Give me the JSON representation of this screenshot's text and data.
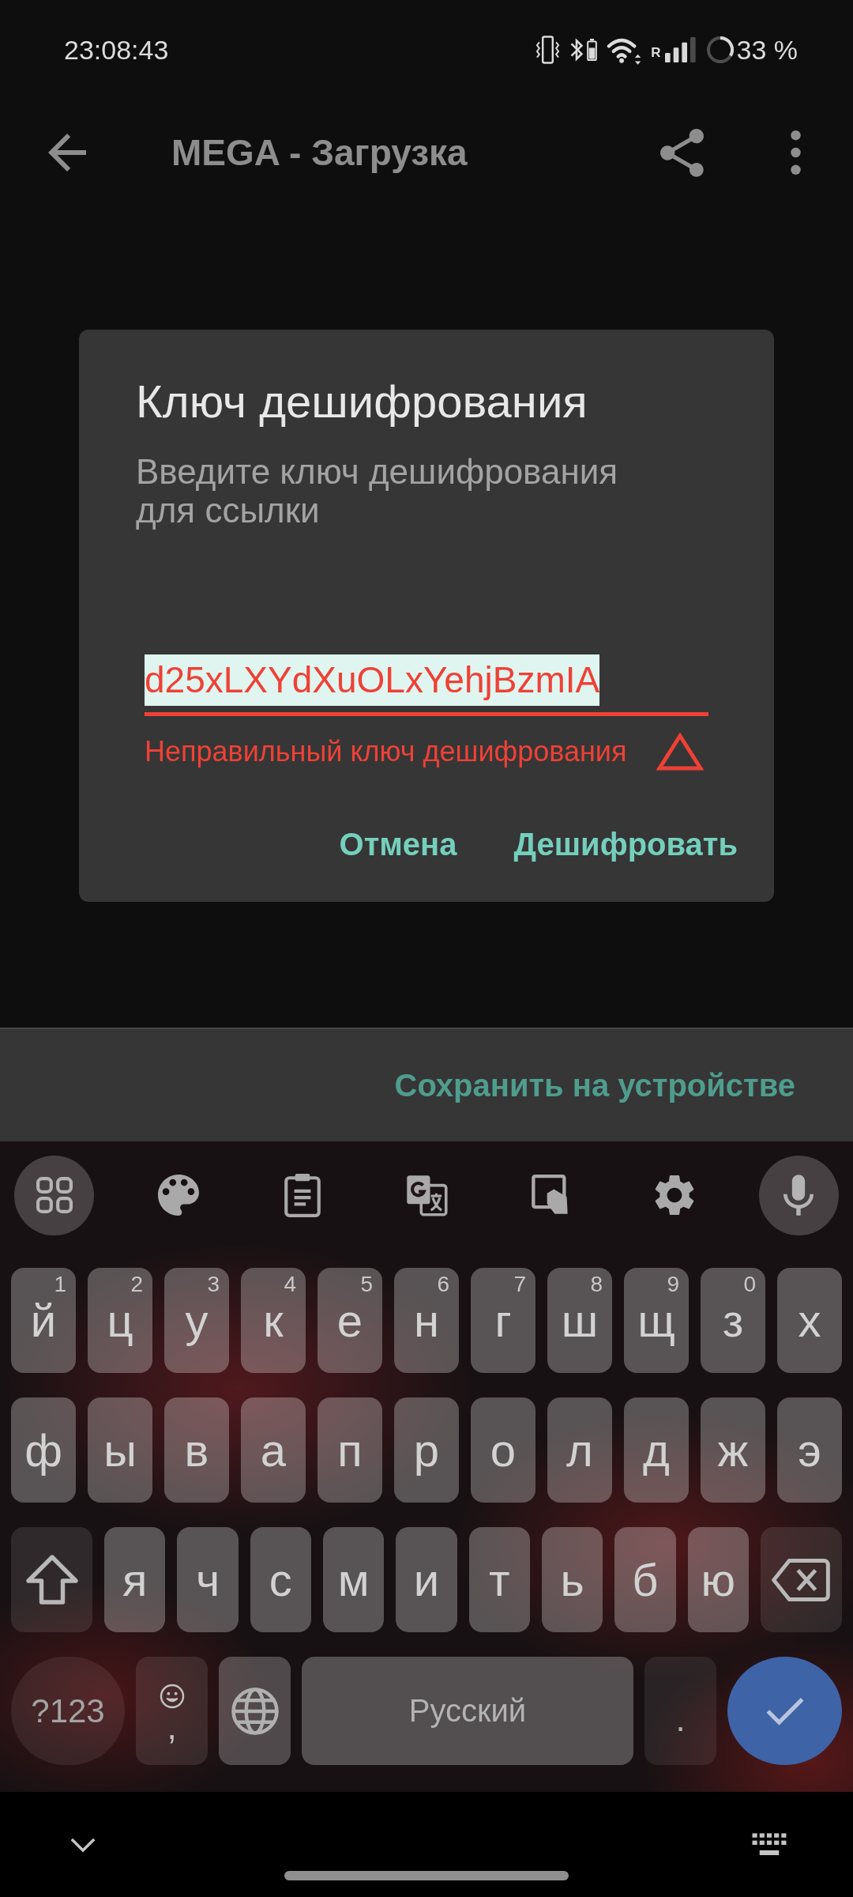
{
  "status_bar": {
    "time": "23:08:43",
    "network_label": "R",
    "battery": "33 %"
  },
  "app_bar": {
    "title": "MEGA - Загрузка"
  },
  "dialog": {
    "title": "Ключ дешифрования",
    "message": "Введите ключ дешифрования для ссылки",
    "field": {
      "value": "d25xLXYdXuOLxYehjBzmIA",
      "selected": true,
      "error": "Неправильный ключ дешифрования"
    },
    "buttons": [
      "Отмена",
      "Дешифровать"
    ]
  },
  "bottom_bar": {
    "button": "Сохранить на устройстве"
  },
  "keyboard": {
    "rows": [
      [
        {
          "kind": "letter",
          "label": "й",
          "hint": "1"
        },
        {
          "kind": "letter",
          "label": "ц",
          "hint": "2"
        },
        {
          "kind": "letter",
          "label": "у",
          "hint": "3"
        },
        {
          "kind": "letter",
          "label": "к",
          "hint": "4"
        },
        {
          "kind": "letter",
          "label": "е",
          "hint": "5"
        },
        {
          "kind": "letter",
          "label": "н",
          "hint": "6"
        },
        {
          "kind": "letter",
          "label": "г",
          "hint": "7"
        },
        {
          "kind": "letter",
          "label": "ш",
          "hint": "8"
        },
        {
          "kind": "letter",
          "label": "щ",
          "hint": "9"
        },
        {
          "kind": "letter",
          "label": "з",
          "hint": "0"
        },
        {
          "kind": "letter",
          "label": "х"
        }
      ],
      [
        {
          "kind": "letter",
          "label": "ф"
        },
        {
          "kind": "letter",
          "label": "ы"
        },
        {
          "kind": "letter",
          "label": "в"
        },
        {
          "kind": "letter",
          "label": "а"
        },
        {
          "kind": "letter",
          "label": "п"
        },
        {
          "kind": "letter",
          "label": "р"
        },
        {
          "kind": "letter",
          "label": "о"
        },
        {
          "kind": "letter",
          "label": "л"
        },
        {
          "kind": "letter",
          "label": "д"
        },
        {
          "kind": "letter",
          "label": "ж"
        },
        {
          "kind": "letter",
          "label": "э"
        }
      ],
      [
        {
          "kind": "shift"
        },
        {
          "kind": "letter",
          "label": "я"
        },
        {
          "kind": "letter",
          "label": "ч"
        },
        {
          "kind": "letter",
          "label": "с"
        },
        {
          "kind": "letter",
          "label": "м"
        },
        {
          "kind": "letter",
          "label": "и"
        },
        {
          "kind": "letter",
          "label": "т"
        },
        {
          "kind": "letter",
          "label": "ь"
        },
        {
          "kind": "letter",
          "label": "б"
        },
        {
          "kind": "letter",
          "label": "ю"
        },
        {
          "kind": "delete"
        }
      ]
    ],
    "bottom_row": [
      {
        "kind": "symbols",
        "label": "?123"
      },
      {
        "kind": "comma",
        "label": ","
      },
      {
        "kind": "globe"
      },
      {
        "kind": "space",
        "label": "Русский"
      },
      {
        "kind": "period",
        "label": "."
      },
      {
        "kind": "enter"
      }
    ]
  }
}
